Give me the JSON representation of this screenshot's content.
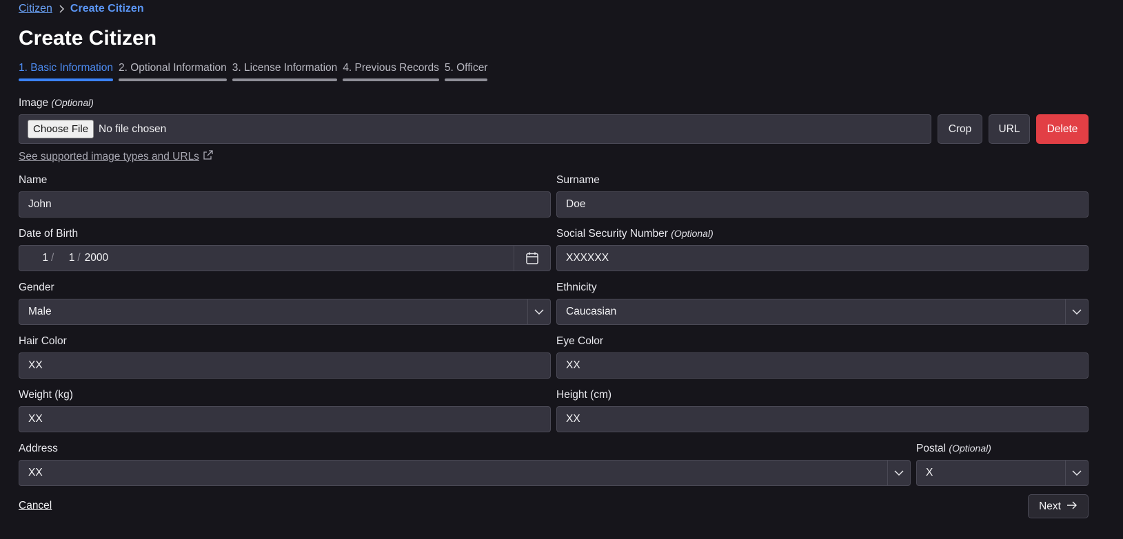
{
  "breadcrumb": {
    "parent": "Citizen",
    "current": "Create Citizen"
  },
  "title": "Create Citizen",
  "steps": [
    {
      "label": "1. Basic Information",
      "active": true
    },
    {
      "label": "2. Optional Information",
      "active": false
    },
    {
      "label": "3. License Information",
      "active": false
    },
    {
      "label": "4. Previous Records",
      "active": false
    },
    {
      "label": "5. Officer",
      "active": false
    }
  ],
  "image": {
    "label": "Image",
    "optional": "(Optional)",
    "choose_file": "Choose File",
    "no_file": "No file chosen",
    "crop": "Crop",
    "url": "URL",
    "delete": "Delete",
    "help_link": "See supported image types and URLs"
  },
  "form": {
    "name": {
      "label": "Name",
      "value": "John"
    },
    "surname": {
      "label": "Surname",
      "value": "Doe"
    },
    "dob": {
      "label": "Date of Birth",
      "month": "1",
      "day": "1",
      "year": "2000"
    },
    "ssn": {
      "label": "Social Security Number",
      "optional": "(Optional)",
      "value": "XXXXXX"
    },
    "gender": {
      "label": "Gender",
      "value": "Male"
    },
    "ethnicity": {
      "label": "Ethnicity",
      "value": "Caucasian"
    },
    "hair_color": {
      "label": "Hair Color",
      "value": "XX"
    },
    "eye_color": {
      "label": "Eye Color",
      "value": "XX"
    },
    "weight": {
      "label": "Weight (kg)",
      "value": "XX"
    },
    "height": {
      "label": "Height (cm)",
      "value": "XX"
    },
    "address": {
      "label": "Address",
      "value": "XX"
    },
    "postal": {
      "label": "Postal",
      "optional": "(Optional)",
      "value": "X"
    }
  },
  "footer": {
    "cancel": "Cancel",
    "next": "Next"
  },
  "colors": {
    "accent": "#3b82f6",
    "danger": "#e23f45",
    "background": "#16151b",
    "field": "#35343f"
  },
  "icons": [
    "chevron-right-icon",
    "external-link-icon",
    "calendar-icon",
    "chevron-down-icon",
    "arrow-right-icon"
  ]
}
